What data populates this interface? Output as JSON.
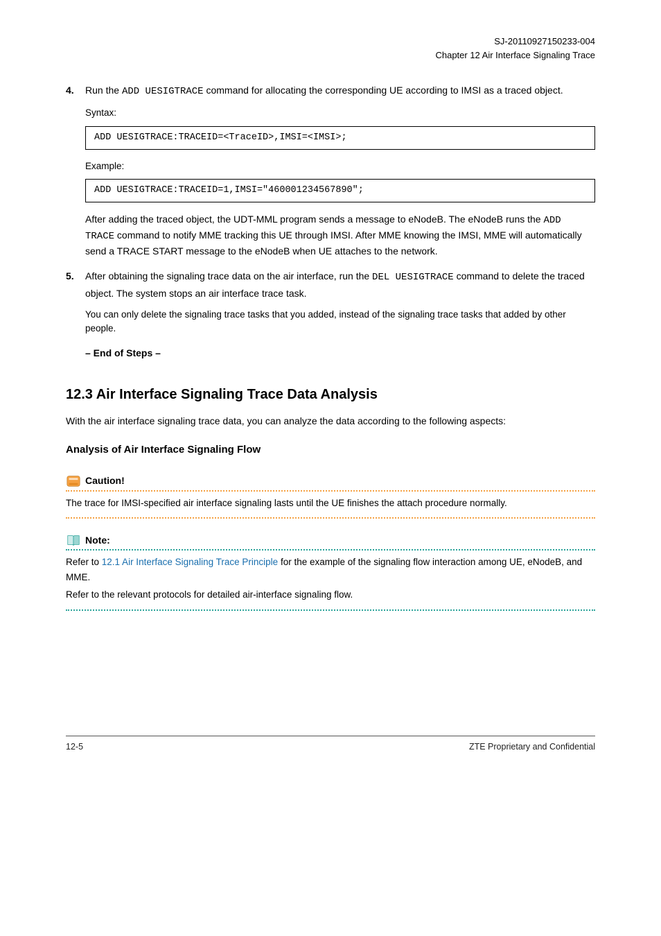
{
  "header": {
    "doc_ref": "SJ-20110927150233-004",
    "chapter_line": "Chapter 12 Air Interface Signaling Trace"
  },
  "steps": {
    "s4": {
      "num": "4.",
      "text_prefix": "Run the ",
      "cmd": "ADD UESIGTRACE",
      "text_suffix": " command for allocating the corresponding UE according to IMSI as a traced object."
    },
    "syntax1": {
      "label": "Syntax:",
      "code": "ADD UESIGTRACE:TRACEID=<TraceID>,IMSI=<IMSI>;"
    },
    "example1": {
      "label": "Example:",
      "code": "ADD UESIGTRACE:TRACEID=1,IMSI=\"460001234567890\";"
    },
    "post": {
      "text_prefix": "After adding the traced object, the UDT-MML program sends a message to eNodeB. The eNodeB runs the ",
      "cmd": "ADD TRACE",
      "text_suffix": " command to notify MME tracking this UE through IMSI. After MME knowing the IMSI, MME will automatically send a TRACE START message to the eNodeB when UE attaches to the network."
    },
    "s5": {
      "num": "5.",
      "text_prefix": "After obtaining the signaling trace data on the air interface, run the ",
      "cmd": "DEL UESIGTRACE",
      "text_suffix": " command to delete the traced object. The system stops an air interface trace task."
    },
    "note": "You can only delete the signaling trace tasks that you added, instead of the signaling trace tasks that added by other people.",
    "end": "– End of Steps –"
  },
  "section": {
    "title": "12.3 Air Interface Signaling Trace Data Analysis",
    "intro": "With the air interface signaling trace data, you can analyze the data according to the following aspects:",
    "subhead": "Analysis of Air Interface Signaling Flow"
  },
  "caution": {
    "label": "Caution!",
    "body": "The trace for IMSI-specified air interface signaling lasts until the UE finishes the attach procedure normally."
  },
  "note_box": {
    "label": "Note:",
    "line1_prefix": "Refer to ",
    "line1_link": "12.1 Air Interface Signaling Trace Principle",
    "line1_suffix": " for the example of the signaling flow interaction among UE, eNodeB, and MME.",
    "line2": "Refer to the relevant protocols for detailed air-interface signaling flow."
  },
  "footer": {
    "left": "12-5",
    "right_line1": "ZTE Proprietary and Confidential",
    "right_line2": ""
  }
}
